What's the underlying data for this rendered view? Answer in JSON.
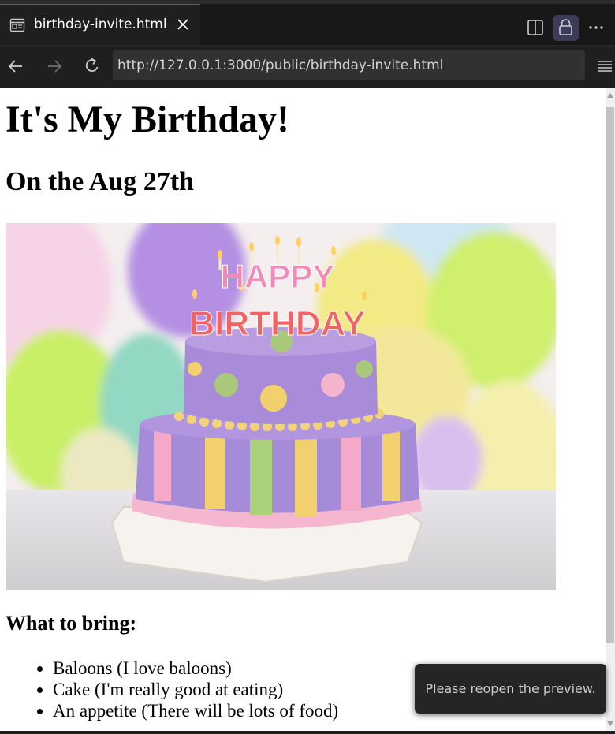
{
  "tab": {
    "title": "birthday-invite.html"
  },
  "navigation": {
    "url": "http://127.0.0.1:3000/public/birthday-invite.html"
  },
  "page": {
    "heading": "It's My Birthday!",
    "subheading": "On the Aug 27th",
    "cake_text_top": "HAPPY",
    "cake_text_bottom": "BIRTHDAY",
    "bring_heading": "What to bring:",
    "bring_items": [
      "Baloons (I love baloons)",
      "Cake (I'm really good at eating)",
      "An appetite (There will be lots of food)"
    ]
  },
  "notification": {
    "message": "Please reopen the preview."
  },
  "colors": {
    "accent": "#0078d4",
    "chrome_bg": "#1f1f1f",
    "page_bg": "#ffffff"
  },
  "icons": [
    "preview-file-icon",
    "close-icon",
    "split-editor-icon",
    "lock-icon",
    "more-icon",
    "back-arrow-icon",
    "forward-arrow-icon",
    "reload-icon",
    "menu-icon"
  ]
}
